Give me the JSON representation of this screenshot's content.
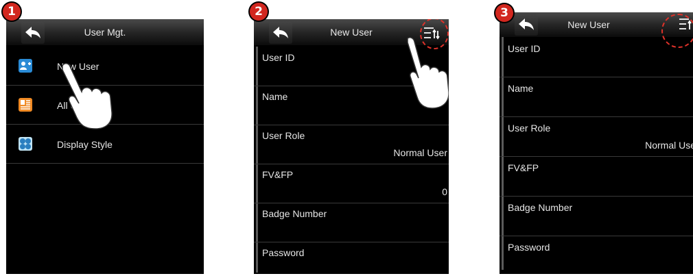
{
  "steps": [
    "1",
    "2",
    "3"
  ],
  "screen1": {
    "title": "User Mgt.",
    "items": [
      {
        "label": "New User",
        "icon": "add-user-icon",
        "color": "#2a8bd6"
      },
      {
        "label": "All Users",
        "icon": "user-list-icon",
        "color": "#f08a24"
      },
      {
        "label": "Display Style",
        "icon": "display-style-icon",
        "color": "#3aa0d8"
      }
    ]
  },
  "screen2": {
    "title": "New User",
    "fields": [
      {
        "label": "User ID",
        "value": ""
      },
      {
        "label": "Name",
        "value": ""
      },
      {
        "label": "User Role",
        "value": "Normal User"
      },
      {
        "label": "FV&FP",
        "value": "0"
      },
      {
        "label": "Badge Number",
        "value": ""
      },
      {
        "label": "Password",
        "value": ""
      }
    ]
  },
  "screen3": {
    "title": "New User",
    "fields": [
      {
        "label": "User ID",
        "value": ""
      },
      {
        "label": "Name",
        "value": ""
      },
      {
        "label": "User Role",
        "value": "Normal Use"
      },
      {
        "label": "FV&FP",
        "value": ""
      },
      {
        "label": "Badge Number",
        "value": ""
      },
      {
        "label": "Password",
        "value": ""
      }
    ]
  },
  "colors": {
    "highlight": "#e0322a",
    "badge": "#d2271f"
  }
}
